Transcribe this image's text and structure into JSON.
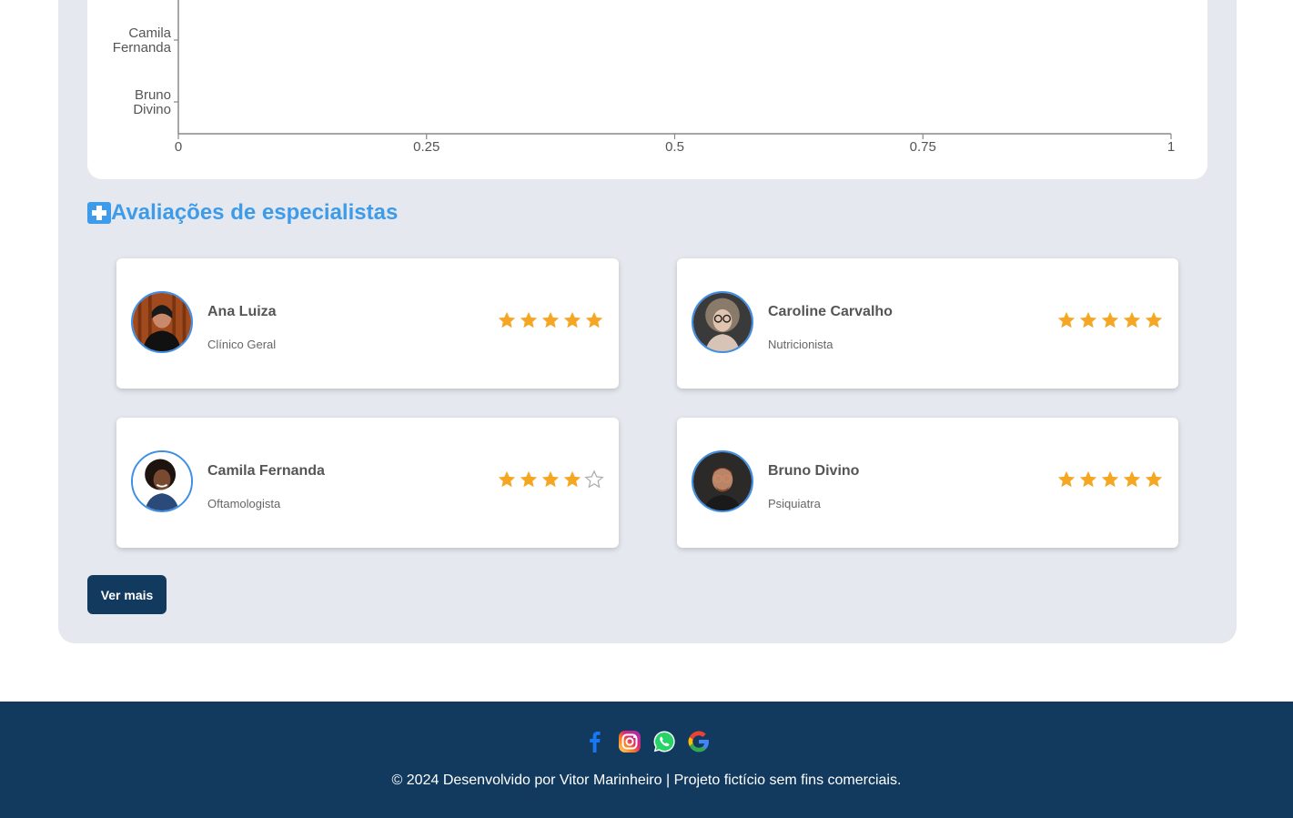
{
  "chart_data": {
    "type": "bar",
    "orientation": "horizontal",
    "categories": [
      "Camila\nFernanda",
      "Bruno\nDivino"
    ],
    "values": [
      0,
      0
    ],
    "x_ticks": [
      "0",
      "0.25",
      "0.5",
      "0.75",
      "1"
    ],
    "xlim": [
      0,
      1
    ],
    "grid": false
  },
  "section": {
    "title": "Avaliações de especialistas",
    "icon": "medical-cross-icon"
  },
  "reviews": [
    {
      "name": "Ana Luiza",
      "specialty": "Clínico Geral",
      "rating": 5
    },
    {
      "name": "Caroline Carvalho",
      "specialty": "Nutricionista",
      "rating": 5
    },
    {
      "name": "Camila Fernanda",
      "specialty": "Oftamologista",
      "rating": 4
    },
    {
      "name": "Bruno Divino",
      "specialty": "Psiquiatra",
      "rating": 5
    }
  ],
  "button": {
    "ver_mais": "Ver mais"
  },
  "footer": {
    "social": [
      "facebook-icon",
      "instagram-icon",
      "whatsapp-icon",
      "google-icon"
    ],
    "copyright": "© 2024 Desenvolvido por Vitor Marinheiro | Projeto fictício sem fins comerciais."
  },
  "colors": {
    "accent": "#3d9be9",
    "star": "#f5a623",
    "footer_bg": "#123a5e",
    "panel_bg": "#e5e8ee"
  }
}
